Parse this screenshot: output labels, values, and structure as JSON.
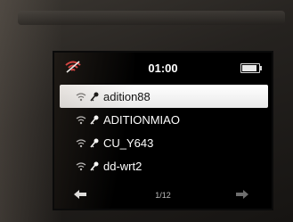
{
  "status_bar": {
    "time": "01:00",
    "wifi_status_icon": "wifi-disconnected-icon",
    "battery_level": 0.9
  },
  "networks": [
    {
      "ssid": "adition88",
      "secured": true,
      "selected": true
    },
    {
      "ssid": "ADITIONMIAO",
      "secured": true,
      "selected": false
    },
    {
      "ssid": "CU_Y643",
      "secured": true,
      "selected": false
    },
    {
      "ssid": "dd-wrt2",
      "secured": true,
      "selected": false
    }
  ],
  "footer": {
    "page_indicator": "1/12",
    "back_icon": "arrow-left-icon",
    "next_icon": "arrow-right-icon"
  },
  "colors": {
    "wifi_off": "#e23a3a",
    "highlight": "#ffffff",
    "text": "#ffffff"
  }
}
